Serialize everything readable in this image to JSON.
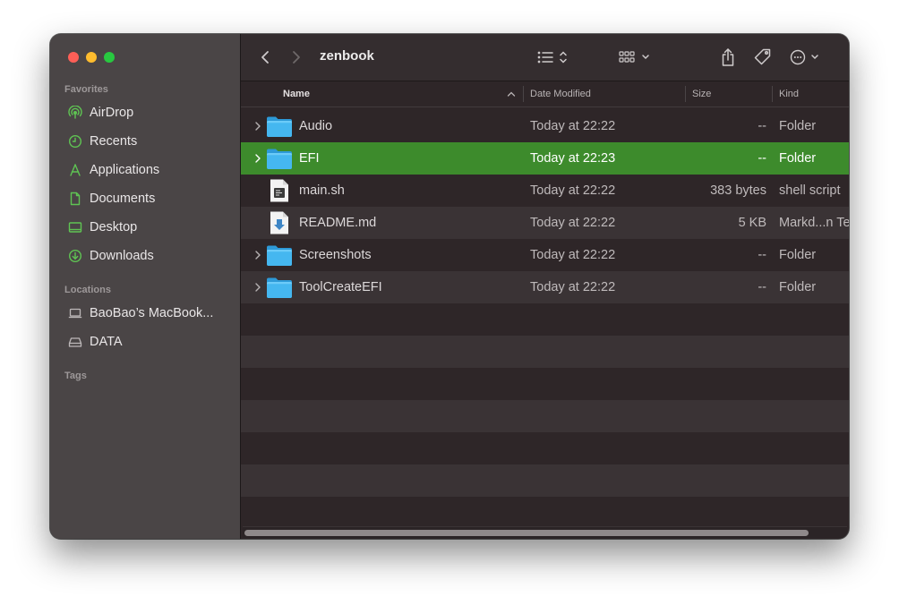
{
  "window": {
    "title": "zenbook"
  },
  "sidebar": {
    "sections": {
      "favorites": "Favorites",
      "locations": "Locations",
      "tags": "Tags"
    },
    "favorites": [
      {
        "label": "AirDrop",
        "icon": "airdrop-icon"
      },
      {
        "label": "Recents",
        "icon": "clock-icon"
      },
      {
        "label": "Applications",
        "icon": "applications-icon"
      },
      {
        "label": "Documents",
        "icon": "document-icon"
      },
      {
        "label": "Desktop",
        "icon": "desktop-icon"
      },
      {
        "label": "Downloads",
        "icon": "download-icon"
      }
    ],
    "locations": [
      {
        "label": "BaoBao’s MacBook...",
        "icon": "laptop-icon"
      },
      {
        "label": "DATA",
        "icon": "drive-icon"
      }
    ]
  },
  "columns": {
    "name": "Name",
    "date": "Date Modified",
    "size": "Size",
    "kind": "Kind"
  },
  "files": [
    {
      "name": "Audio",
      "date": "Today at 22:22",
      "size": "--",
      "kind": "Folder",
      "type": "folder"
    },
    {
      "name": "EFI",
      "date": "Today at 22:23",
      "size": "--",
      "kind": "Folder",
      "type": "folder",
      "selected": true
    },
    {
      "name": "main.sh",
      "date": "Today at 22:22",
      "size": "383 bytes",
      "kind": "shell script",
      "type": "script"
    },
    {
      "name": "README.md",
      "date": "Today at 22:22",
      "size": "5 KB",
      "kind": "Markd...n Te",
      "type": "markdown"
    },
    {
      "name": "Screenshots",
      "date": "Today at 22:22",
      "size": "--",
      "kind": "Folder",
      "type": "folder"
    },
    {
      "name": "ToolCreateEFI",
      "date": "Today at 22:22",
      "size": "--",
      "kind": "Folder",
      "type": "folder"
    }
  ],
  "colors": {
    "selection": "#3d8b2c",
    "sidebar_icon": "#5fc453",
    "folder": "#3fb2ee"
  }
}
